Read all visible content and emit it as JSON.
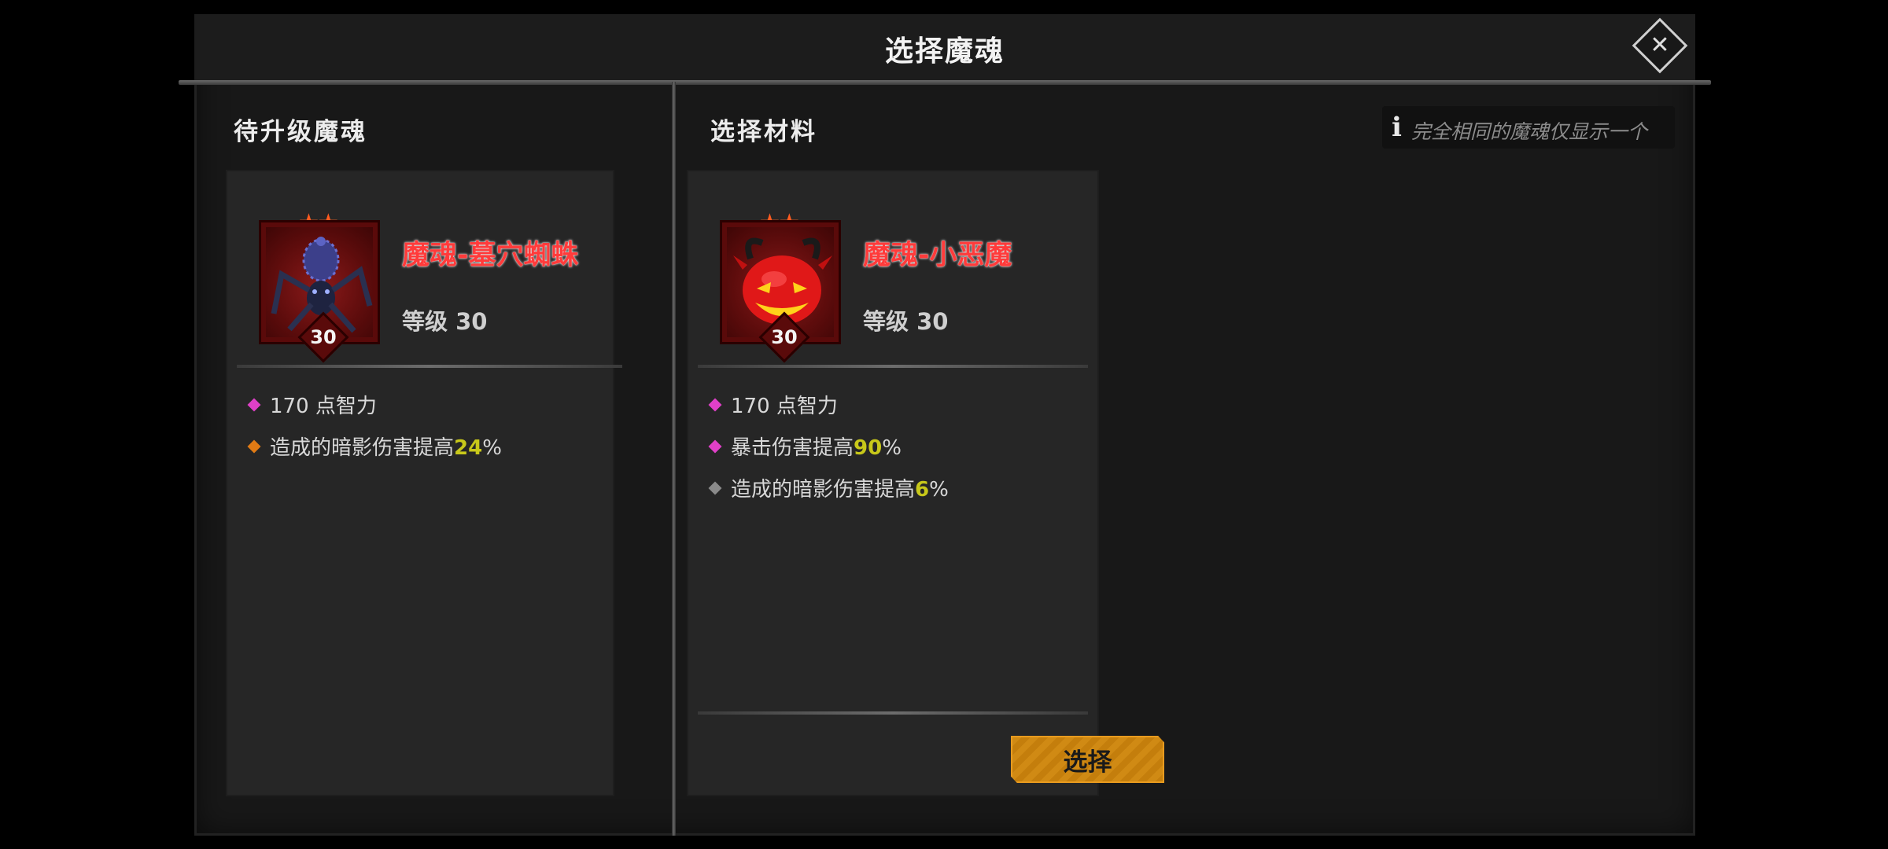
{
  "dialog": {
    "title": "选择魔魂",
    "close_icon": "close-x-icon"
  },
  "left_panel": {
    "section_title": "待升级魔魂",
    "soul": {
      "name": "魔魂-墓穴蜘蛛",
      "level_text": "等级 30",
      "badge_level": "30",
      "star_count": 2,
      "stars": "★★",
      "portrait_icon": "crypt-spider-icon",
      "stats": [
        {
          "prefix": "170 点智力",
          "value": "",
          "suffix": "",
          "bullet_color": "#e040c8"
        },
        {
          "prefix": "造成的暗影伤害提高",
          "value": "24",
          "suffix": "%",
          "bullet_color": "#e07a14"
        }
      ]
    }
  },
  "right_panel": {
    "section_title": "选择材料",
    "info_note": "完全相同的魔魂仅显示一个",
    "info_icon": "info-icon",
    "soul": {
      "name": "魔魂-小恶魔",
      "level_text": "等级 30",
      "badge_level": "30",
      "star_count": 2,
      "stars": "★★",
      "portrait_icon": "imp-pumpkin-icon",
      "stats": [
        {
          "prefix": "170 点智力",
          "value": "",
          "suffix": "",
          "bullet_color": "#e040c8"
        },
        {
          "prefix": "暴击伤害提高",
          "value": "90",
          "suffix": "%",
          "bullet_color": "#e040c8"
        },
        {
          "prefix": "造成的暗影伤害提高",
          "value": "6",
          "suffix": "%",
          "bullet_color": "#8a8a8a"
        }
      ]
    },
    "select_button": "选择"
  },
  "colors": {
    "highlight_value": "#c8c81a",
    "soul_name": "#ff3b3b",
    "button": "#d08a14"
  }
}
